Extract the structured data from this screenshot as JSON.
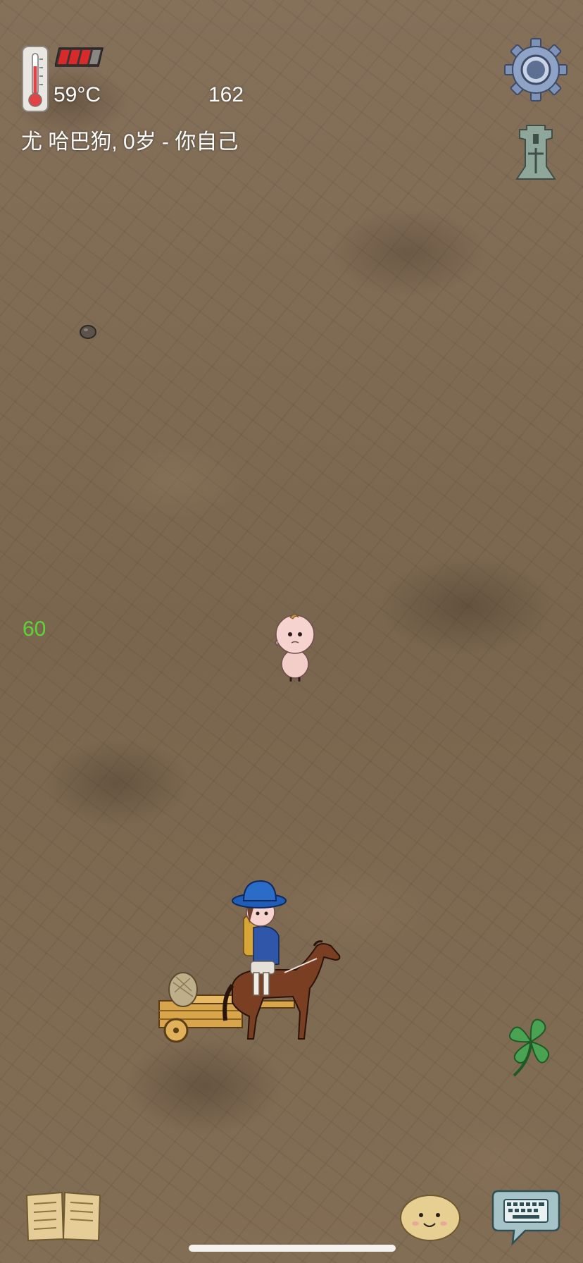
{
  "hud": {
    "temperature": "59°C",
    "counter": "162",
    "name_line": "尤 哈巴狗, 0岁 - 你自己",
    "side_number": "60",
    "health_bars": 3
  },
  "icons": {
    "thermometer": "thermometer-icon",
    "gear": "gear-icon",
    "coin": "spade-coin-icon",
    "clover": "four-leaf-clover-icon",
    "book": "recipe-book-icon",
    "emote": "emote-face-icon",
    "keyboard": "keyboard-chat-icon"
  },
  "colors": {
    "ground": "#7d6a52",
    "hud_text": "#ffffff",
    "side_number": "#5fd33a",
    "health": "#d82a2a"
  }
}
